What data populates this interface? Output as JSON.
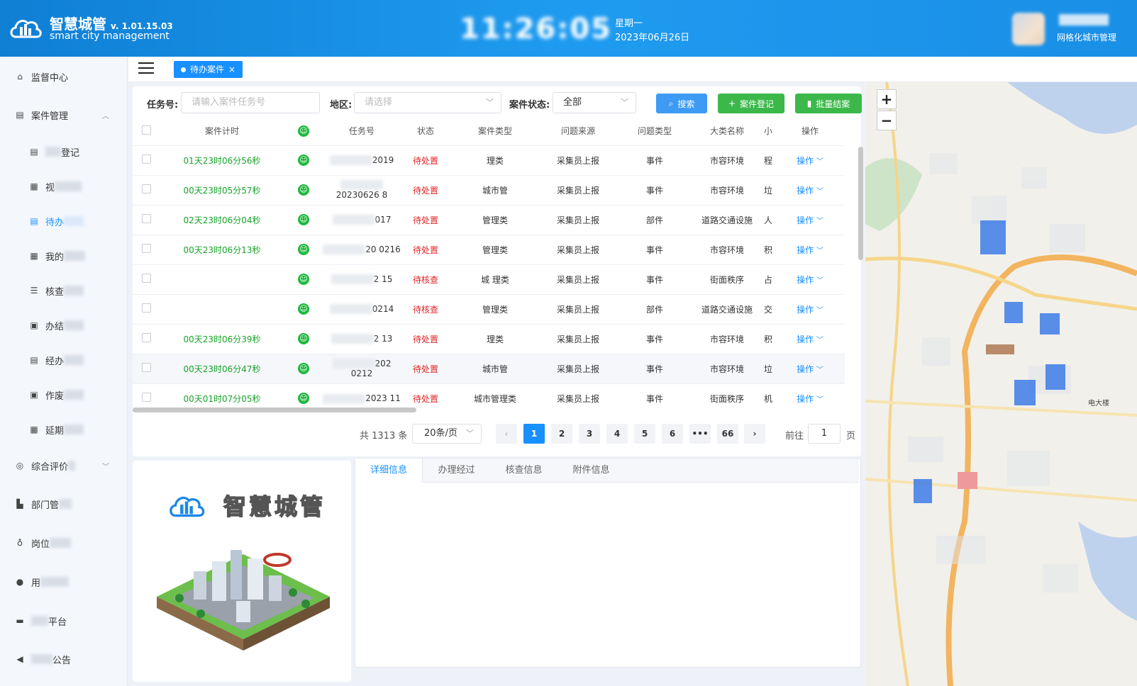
{
  "header": {
    "title": "智慧城管",
    "version": "v. 1.01.15.03",
    "subtitle": "smart city management",
    "weekday": "星期一",
    "date": "2023年06月26日",
    "user_role": "网格化城市管理"
  },
  "sidebar": {
    "items": [
      {
        "label": "监督中心"
      },
      {
        "label": "案件管理"
      },
      {
        "label": "登记"
      },
      {
        "label": "视"
      },
      {
        "label": "待办"
      },
      {
        "label": "我的"
      },
      {
        "label": "核查"
      },
      {
        "label": "办结"
      },
      {
        "label": "经办"
      },
      {
        "label": "作废"
      },
      {
        "label": "延期"
      },
      {
        "label": "综合评价"
      },
      {
        "label": "部门管"
      },
      {
        "label": "岗位"
      },
      {
        "label": "用"
      },
      {
        "label": "平台"
      },
      {
        "label": "公告"
      }
    ]
  },
  "tabs": {
    "active": "待办案件",
    "close": "×"
  },
  "filters": {
    "task_label": "任务号:",
    "task_placeholder": "请输入案件任务号",
    "region_label": "地区:",
    "region_placeholder": "请选择",
    "status_label": "案件状态:",
    "status_value": "全部",
    "search_btn": "搜索",
    "register_btn": "案件登记",
    "batch_btn": "批量结案"
  },
  "table": {
    "headers": [
      "案件计时",
      "任务号",
      "状态",
      "案件类型",
      "问题来源",
      "问题类型",
      "大类名称",
      "小",
      "操作"
    ],
    "rows": [
      {
        "timer": "01天23时06分56秒",
        "task": "2019",
        "status": "待处置",
        "type": "理类",
        "source": "采集员上报",
        "ptype": "事件",
        "cat": "市容环境",
        "sub": "程",
        "op": "操作"
      },
      {
        "timer": "00天23时05分57秒",
        "task": "20230626 8",
        "status": "待处置",
        "type": "城市管",
        "source": "采集员上报",
        "ptype": "事件",
        "cat": "市容环境",
        "sub": "垃",
        "op": "操作"
      },
      {
        "timer": "02天23时06分04秒",
        "task": "017",
        "status": "待处置",
        "type": "管理类",
        "source": "采集员上报",
        "ptype": "部件",
        "cat": "道路交通设施",
        "sub": "人",
        "op": "操作"
      },
      {
        "timer": "00天23时06分13秒",
        "task": "20 0216",
        "status": "待处置",
        "type": "管理类",
        "source": "采集员上报",
        "ptype": "事件",
        "cat": "市容环境",
        "sub": "积",
        "op": "操作"
      },
      {
        "timer": "",
        "task": "2 15",
        "status": "待核查",
        "type": "城 理类",
        "source": "采集员上报",
        "ptype": "事件",
        "cat": "街面秩序",
        "sub": "占",
        "op": "操作"
      },
      {
        "timer": "",
        "task": "0214",
        "status": "待核查",
        "type": "管理类",
        "source": "采集员上报",
        "ptype": "部件",
        "cat": "道路交通设施",
        "sub": "交",
        "op": "操作"
      },
      {
        "timer": "00天23时06分39秒",
        "task": "2 13",
        "status": "待处置",
        "type": "理类",
        "source": "采集员上报",
        "ptype": "事件",
        "cat": "市容环境",
        "sub": "积",
        "op": "操作"
      },
      {
        "timer": "00天23时06分47秒",
        "task": "202 0212",
        "status": "待处置",
        "type": "城市管",
        "source": "采集员上报",
        "ptype": "事件",
        "cat": "市容环境",
        "sub": "垃",
        "op": "操作"
      },
      {
        "timer": "00天01时07分05秒",
        "task": "2023 11",
        "status": "待处置",
        "type": "城市管理类",
        "source": "采集员上报",
        "ptype": "事件",
        "cat": "街面秩序",
        "sub": "机",
        "op": "操作"
      }
    ]
  },
  "pagination": {
    "total": "共 1313 条",
    "page_size": "20条/页",
    "pages": [
      "1",
      "2",
      "3",
      "4",
      "5",
      "6",
      "•••",
      "66"
    ],
    "prev": "‹",
    "next": "›",
    "goto_label": "前往",
    "goto_value": "1",
    "page_suffix": "页"
  },
  "logo_panel": {
    "title": "智慧城管"
  },
  "detail_tabs": [
    "详细信息",
    "办理经过",
    "核查信息",
    "附件信息"
  ],
  "map": {
    "zoom_in": "+",
    "zoom_out": "−",
    "label_right": "电大楼"
  },
  "colors": {
    "primary": "#1890ff",
    "green": "#3cb84a",
    "header": "#1a8fe6",
    "red": "#e02424"
  }
}
